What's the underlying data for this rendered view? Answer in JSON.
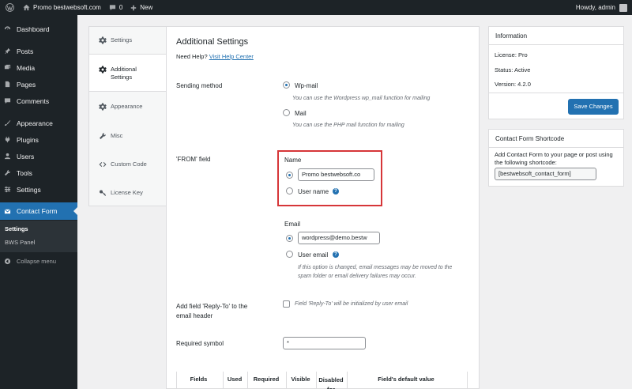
{
  "admin_bar": {
    "site_name": "Promo bestwebsoft.com",
    "comments_count": "0",
    "new_label": "New",
    "howdy": "Howdy, admin"
  },
  "menu": {
    "items": [
      {
        "label": "Dashboard",
        "icon": "dashboard-icon"
      },
      {
        "label": "Posts",
        "icon": "pin-icon"
      },
      {
        "label": "Media",
        "icon": "media-icon"
      },
      {
        "label": "Pages",
        "icon": "page-icon"
      },
      {
        "label": "Comments",
        "icon": "comment-icon"
      },
      {
        "label": "Appearance",
        "icon": "brush-icon"
      },
      {
        "label": "Plugins",
        "icon": "plug-icon"
      },
      {
        "label": "Users",
        "icon": "user-icon"
      },
      {
        "label": "Tools",
        "icon": "wrench-icon"
      },
      {
        "label": "Settings",
        "icon": "sliders-icon"
      },
      {
        "label": "Contact Form",
        "icon": "envelope-icon"
      }
    ],
    "submenu": [
      "Settings",
      "BWS Panel"
    ],
    "collapse": "Collapse menu"
  },
  "tabs": [
    {
      "label": "Settings",
      "icon": "gear-icon"
    },
    {
      "label": "Additional Settings",
      "icon": "gear-icon"
    },
    {
      "label": "Appearance",
      "icon": "gear-icon"
    },
    {
      "label": "Misc",
      "icon": "wrench-icon"
    },
    {
      "label": "Custom Code",
      "icon": "code-icon"
    },
    {
      "label": "License Key",
      "icon": "key-icon"
    }
  ],
  "main": {
    "title": "Additional Settings",
    "help_prefix": "Need Help?",
    "help_link": "Visit Help Center",
    "sending_method": {
      "label": "Sending method",
      "wpmail": "Wp-mail",
      "wpmail_desc": "You can use the Wordpress wp_mail function for mailing",
      "mail": "Mail",
      "mail_desc": "You can use the PHP mail function for mailing"
    },
    "from_field": {
      "label": "'FROM' field",
      "name_heading": "Name",
      "name_value": "Promo bestwebsoft.co",
      "user_name": "User name",
      "email_heading": "Email",
      "email_value": "wordpress@demo.bestw",
      "user_email": "User email",
      "email_note": "If this option is changed, email messages may be moved to the spam folder or email delivery failures may occur."
    },
    "reply_to": {
      "label": "Add field 'Reply-To' to the email header",
      "desc": "Field 'Reply-To' will be initialized by user email"
    },
    "required_symbol": {
      "label": "Required symbol",
      "value": "*"
    },
    "table_headers": [
      "Fields",
      "Used",
      "Required",
      "Visible",
      "Disabled for",
      "Field's default value"
    ]
  },
  "info": {
    "title": "Information",
    "license": "License: Pro",
    "status": "Status: Active",
    "version": "Version: 4.2.0",
    "save_label": "Save Changes"
  },
  "shortcode": {
    "title": "Contact Form Shortcode",
    "desc": "Add Contact Form to your page or post using the following shortcode:",
    "code": "[bestwebsoft_contact_form]"
  },
  "colors": {
    "accent": "#2271b1",
    "admin_dark": "#1d2327",
    "highlight": "#d63638"
  }
}
